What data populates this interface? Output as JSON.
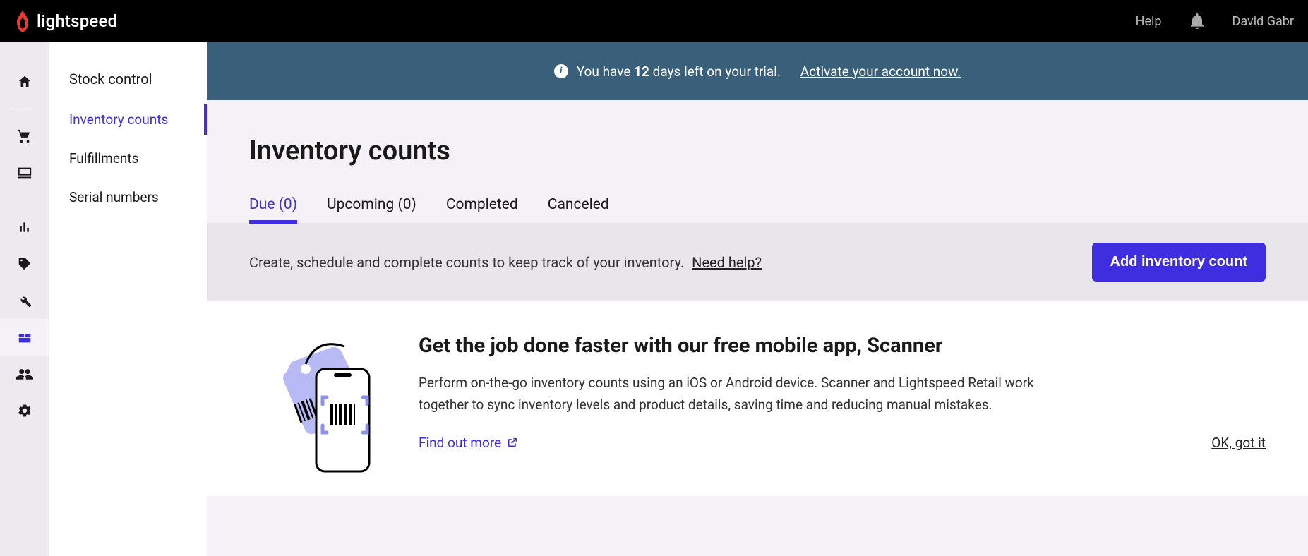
{
  "header": {
    "brand": "lightspeed",
    "help": "Help",
    "user": "David Gabr"
  },
  "subnav": {
    "title": "Stock control",
    "items": [
      "Inventory counts",
      "Fulfillments",
      "Serial numbers"
    ]
  },
  "trial": {
    "prefix": "You have ",
    "days": "12",
    "suffix": " days left on your trial.",
    "cta": "Activate your account now."
  },
  "page": {
    "title": "Inventory counts"
  },
  "tabs": {
    "due": "Due (0)",
    "upcoming": "Upcoming (0)",
    "completed": "Completed",
    "canceled": "Canceled"
  },
  "action": {
    "desc": "Create, schedule and complete counts to keep track of your inventory.",
    "help": "Need help?",
    "button": "Add inventory count"
  },
  "promo": {
    "title": "Get the job done faster with our free mobile app, Scanner",
    "desc": "Perform on-the-go inventory counts using an iOS or Android device. Scanner and Lightspeed Retail work together to sync inventory levels and product details, saving time and reducing manual mistakes.",
    "find_more": "Find out more",
    "ok": "OK, got it"
  }
}
